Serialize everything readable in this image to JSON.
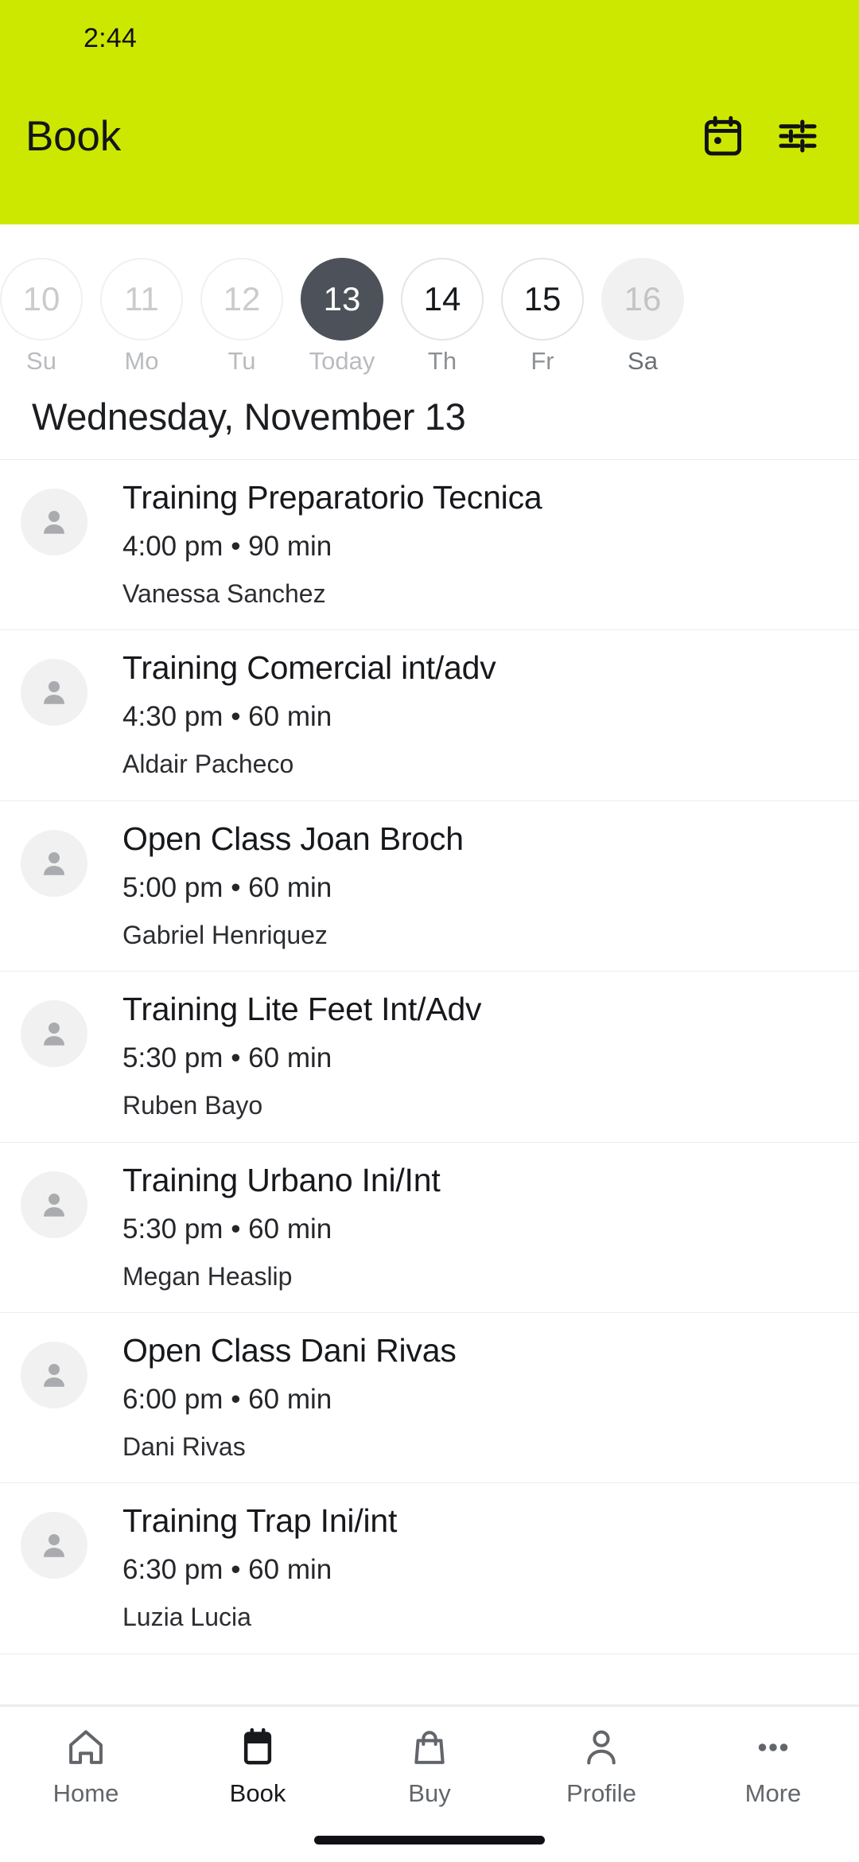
{
  "theme": {
    "accent": "#cde800",
    "selected_day_bg": "#4c515a",
    "text_primary": "#16181c",
    "text_muted": "#b9bbbe",
    "divider": "#ececec"
  },
  "status_bar": {
    "time": "2:44"
  },
  "header": {
    "title": "Book",
    "actions": [
      {
        "name": "calendar-icon",
        "label": "Calendar"
      },
      {
        "name": "filter-icon",
        "label": "Filters"
      }
    ]
  },
  "date_strip": [
    {
      "day_number": "10",
      "weekday": "Su",
      "state": "past"
    },
    {
      "day_number": "11",
      "weekday": "Mo",
      "state": "past"
    },
    {
      "day_number": "12",
      "weekday": "Tu",
      "state": "past"
    },
    {
      "day_number": "13",
      "weekday": "Today",
      "state": "selected"
    },
    {
      "day_number": "14",
      "weekday": "Th",
      "state": "future"
    },
    {
      "day_number": "15",
      "weekday": "Fr",
      "state": "future"
    },
    {
      "day_number": "16",
      "weekday": "Sa",
      "state": "muted"
    }
  ],
  "day_heading": "Wednesday, November 13",
  "classes": [
    {
      "title": "Training Preparatorio Tecnica",
      "meta": "4:00 pm • 90 min",
      "instructor": "Vanessa Sanchez"
    },
    {
      "title": "Training Comercial int/adv",
      "meta": "4:30 pm • 60 min",
      "instructor": "Aldair Pacheco"
    },
    {
      "title": "Open Class Joan Broch",
      "meta": "5:00 pm • 60 min",
      "instructor": "Gabriel Henriquez"
    },
    {
      "title": "Training Lite Feet Int/Adv",
      "meta": "5:30 pm • 60 min",
      "instructor": "Ruben Bayo"
    },
    {
      "title": "Training Urbano Ini/Int",
      "meta": "5:30 pm • 60 min",
      "instructor": "Megan Heaslip"
    },
    {
      "title": "Open Class Dani Rivas",
      "meta": "6:00 pm • 60 min",
      "instructor": "Dani Rivas"
    },
    {
      "title": "Training Trap Ini/int",
      "meta": "6:30 pm • 60 min",
      "instructor": "Luzia Lucia"
    }
  ],
  "bottom_nav": {
    "active_index": 1,
    "items": [
      {
        "label": "Home",
        "icon": "home-icon"
      },
      {
        "label": "Book",
        "icon": "calendar-icon"
      },
      {
        "label": "Buy",
        "icon": "shopping-bag-icon"
      },
      {
        "label": "Profile",
        "icon": "person-icon"
      },
      {
        "label": "More",
        "icon": "ellipsis-icon"
      }
    ]
  }
}
